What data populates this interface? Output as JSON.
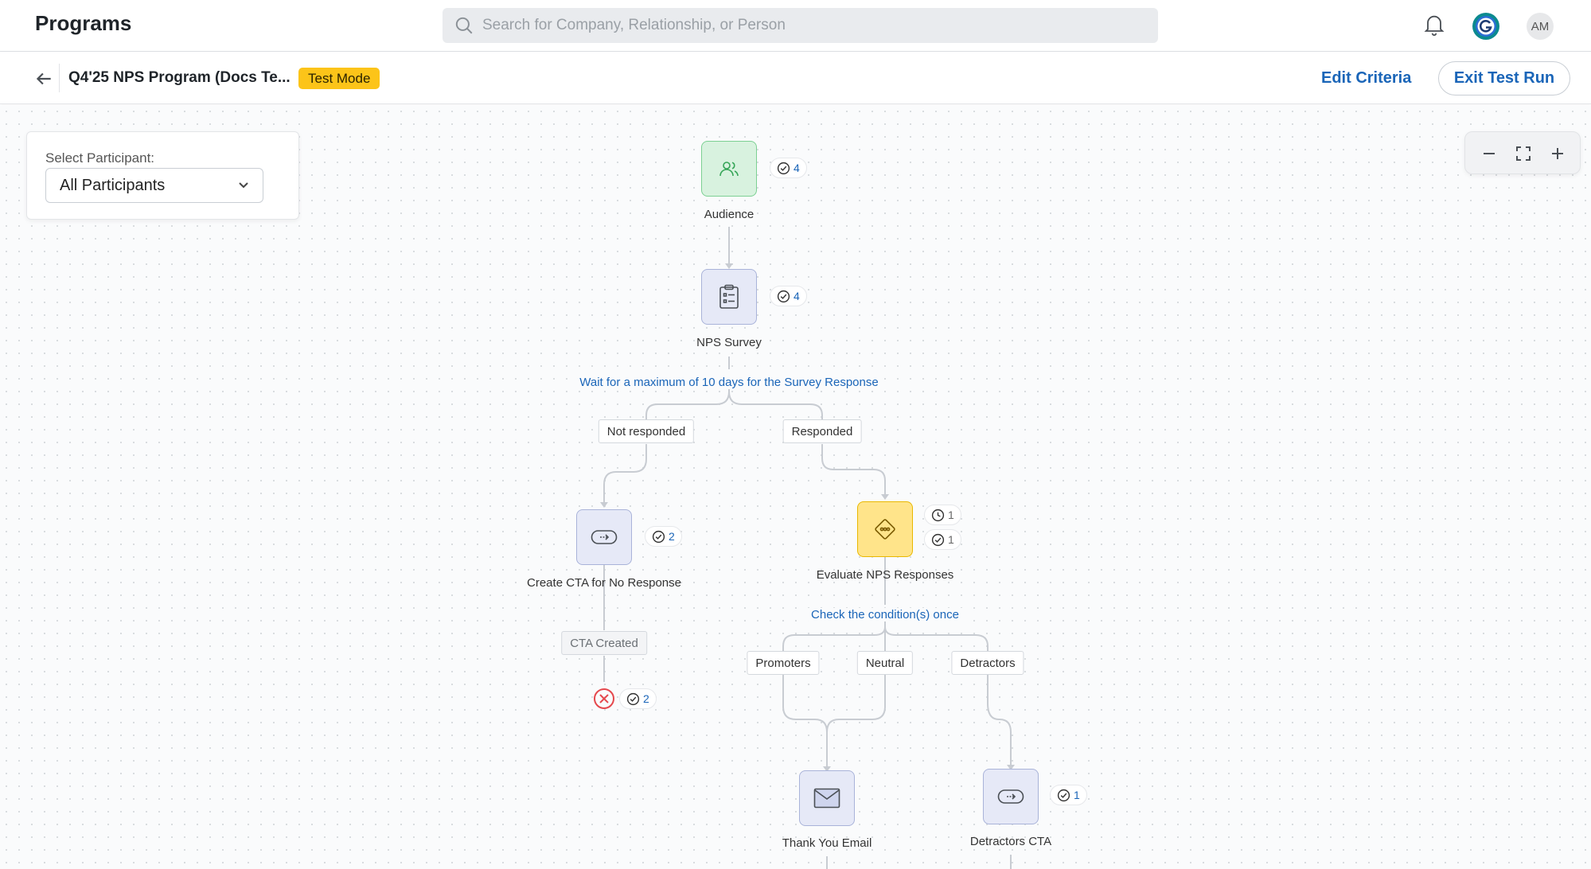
{
  "topbar": {
    "app_title": "Programs",
    "search_placeholder": "Search for Company, Relationship, or Person",
    "avatar_initials": "AM"
  },
  "subbar": {
    "program_name": "Q4'25 NPS Program (Docs Te...",
    "mode_badge": "Test Mode",
    "edit_criteria": "Edit Criteria",
    "exit_test_run": "Exit Test Run"
  },
  "participant": {
    "label": "Select Participant:",
    "selected": "All Participants"
  },
  "flow": {
    "audience": {
      "label": "Audience",
      "count": "4"
    },
    "nps_survey": {
      "label": "NPS Survey",
      "count": "4"
    },
    "survey_wait": "Wait for a maximum of 10 days for the Survey Response",
    "branch_not_responded": "Not responded",
    "branch_responded": "Responded",
    "create_cta": {
      "label": "Create CTA for No Response",
      "count": "2"
    },
    "cta_created": "CTA Created",
    "exit_count": "2",
    "evaluate": {
      "label": "Evaluate NPS Responses",
      "waiting_count": "1",
      "done_count": "1"
    },
    "condition_text": "Check the condition(s) once",
    "branch_promoters": "Promoters",
    "branch_neutral": "Neutral",
    "branch_detractors": "Detractors",
    "thank_you": {
      "label": "Thank You Email"
    },
    "detractors_cta": {
      "label": "Detractors CTA",
      "count": "1"
    }
  },
  "colors": {
    "accent_blue": "#1a65b8",
    "badge_yellow": "#fcc419",
    "audience_green": "#d8f2df",
    "evaluate_yellow": "#ffe48a",
    "exit_red": "#e5484d"
  }
}
